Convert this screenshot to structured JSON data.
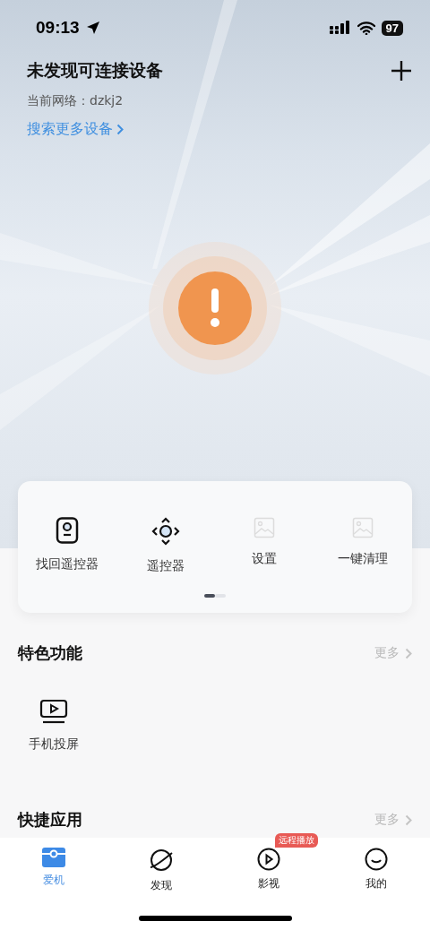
{
  "status_bar": {
    "time": "09:13",
    "battery": "97"
  },
  "header": {
    "title": "未发现可连接设备",
    "network": "当前网络：dzkj2",
    "search_link": "搜索更多设备"
  },
  "alert": {
    "kind": "warning"
  },
  "quick_actions": {
    "items": [
      {
        "label": "找回遥控器",
        "kind": "remote"
      },
      {
        "label": "遥控器",
        "kind": "dpad"
      },
      {
        "label": "设置",
        "kind": "placeholder"
      },
      {
        "label": "一键清理",
        "kind": "placeholder"
      }
    ],
    "pages": [
      {
        "selected": true
      },
      {
        "selected": false
      }
    ]
  },
  "sections": [
    {
      "title": "特色功能",
      "more": "更多",
      "items": [
        {
          "label": "手机投屏",
          "kind": "cast"
        }
      ]
    },
    {
      "title": "快捷应用",
      "more": "更多"
    }
  ],
  "tab_bar": [
    {
      "label": "爱机",
      "kind": "device",
      "selected": true
    },
    {
      "label": "发现",
      "kind": "planet",
      "selected": false
    },
    {
      "label": "影视",
      "kind": "play",
      "selected": false,
      "badge": "远程播放"
    },
    {
      "label": "我的",
      "kind": "smile",
      "selected": false
    }
  ]
}
